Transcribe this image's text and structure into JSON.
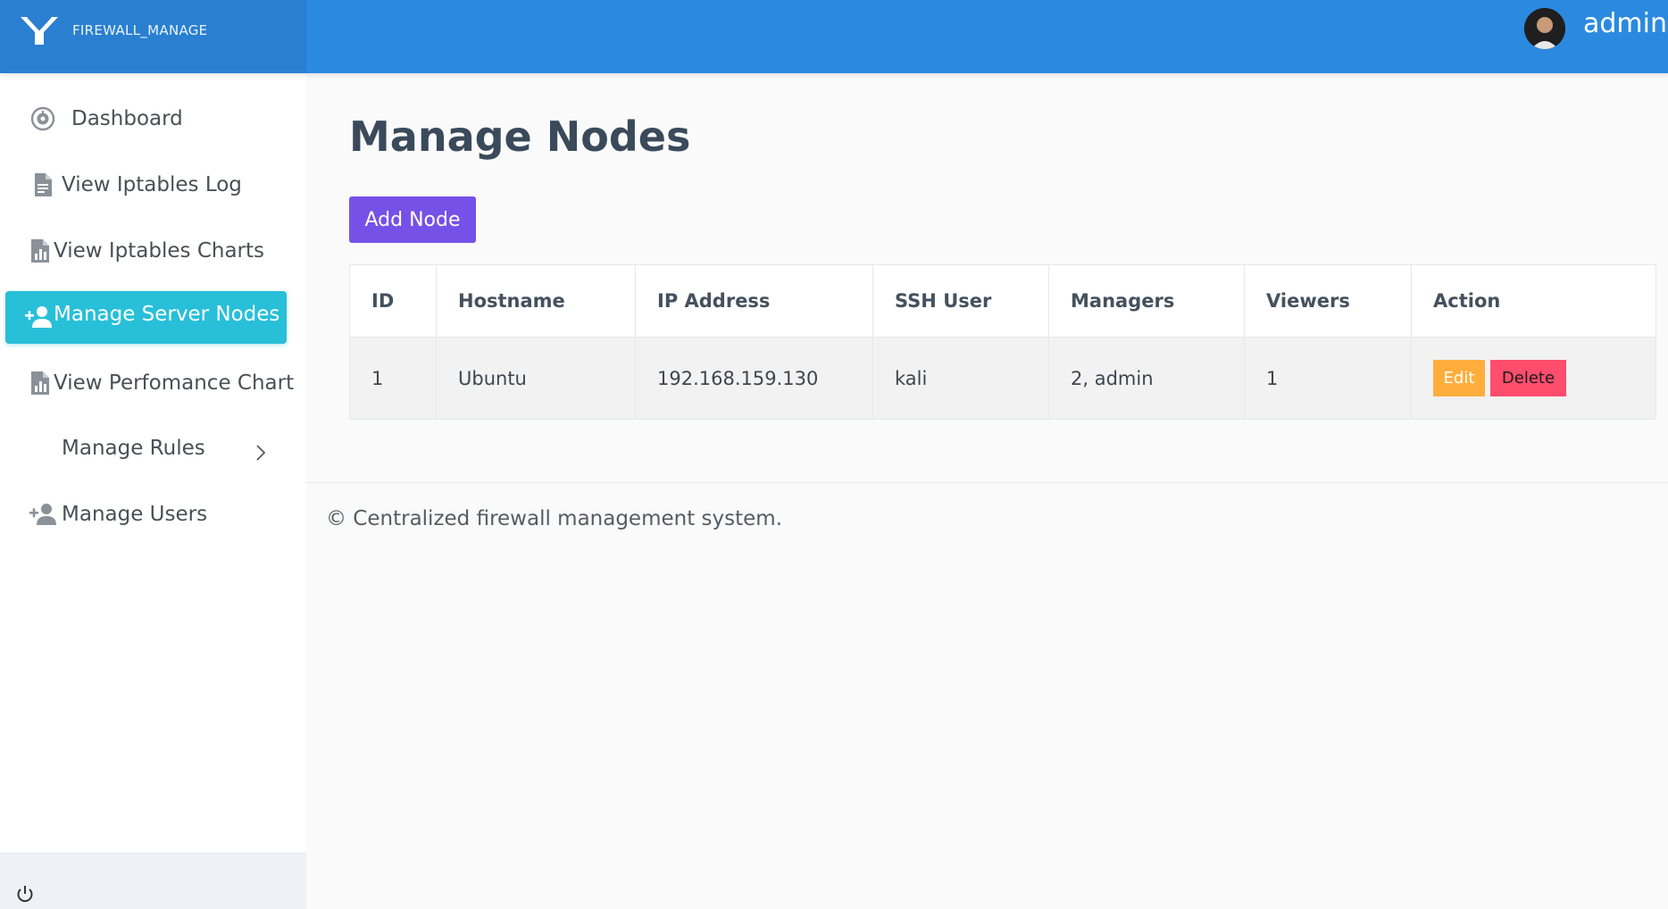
{
  "header": {
    "brand_name": "FIREWALL_MANAGE",
    "username": "admin",
    "brand_color": "#2b8ae0"
  },
  "sidebar": {
    "items": [
      {
        "label": "Dashboard",
        "icon": "dashboard-gauge-icon"
      },
      {
        "label": "View Iptables Log",
        "icon": "document-icon"
      },
      {
        "label": "View Iptables Charts",
        "icon": "chart-file-icon"
      },
      {
        "label": "Manage Server Nodes",
        "icon": "add-user-icon",
        "active": true
      },
      {
        "label": "View Perfomance Chart",
        "icon": "chart-file-icon"
      },
      {
        "label": "Manage Rules",
        "icon": "chevron-right-icon"
      },
      {
        "label": "Manage Users",
        "icon": "add-user-icon"
      }
    ],
    "active_color": "#28bfd8"
  },
  "main": {
    "title": "Manage Nodes",
    "add_button": "Add Node",
    "table": {
      "headers": [
        "ID",
        "Hostname",
        "IP Address",
        "SSH User",
        "Managers",
        "Viewers",
        "Action"
      ],
      "rows": [
        {
          "id": "1",
          "hostname": "Ubuntu",
          "ip": "192.168.159.130",
          "ssh_user": "kali",
          "managers": "2, admin",
          "viewers": "1"
        }
      ],
      "edit_label": "Edit",
      "delete_label": "Delete"
    },
    "footer": "© Centralized firewall management system."
  }
}
